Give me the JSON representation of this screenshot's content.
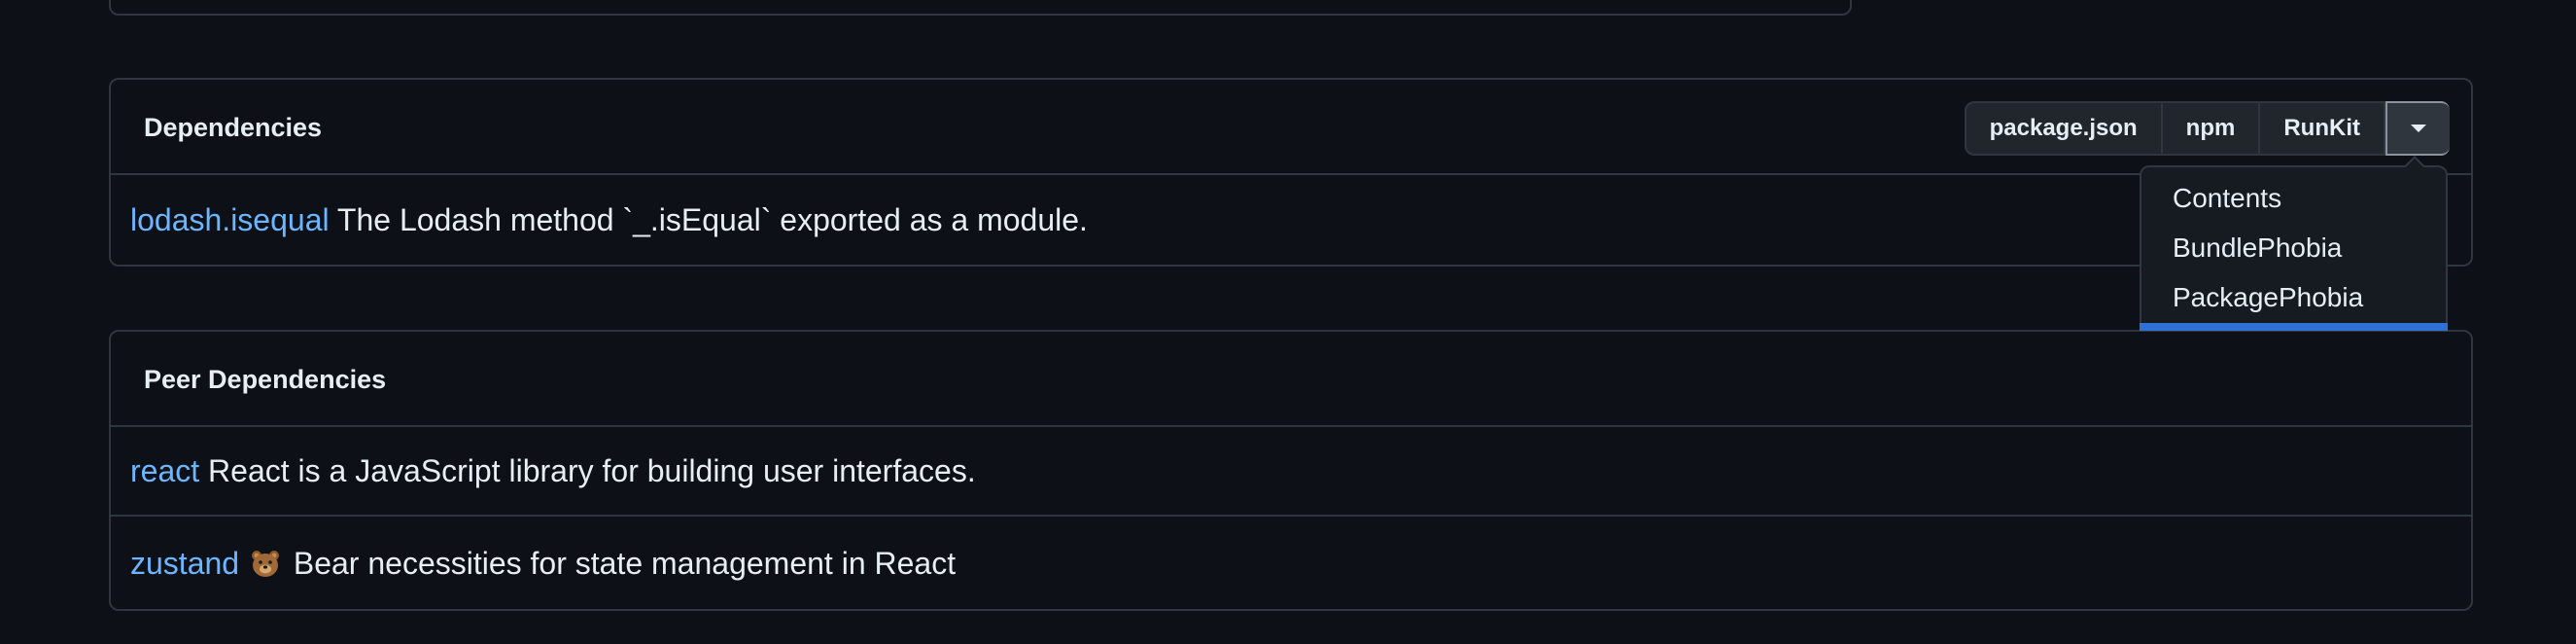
{
  "dependencies": {
    "title": "Dependencies",
    "buttons": {
      "package_json": "package.json",
      "npm": "npm",
      "runkit": "RunKit"
    },
    "items": [
      {
        "name": "lodash.isequal",
        "description": "The Lodash method `_.isEqual` exported as a module."
      }
    ]
  },
  "dropdown": {
    "items": [
      "Contents",
      "BundlePhobia",
      "PackagePhobia"
    ]
  },
  "peer_dependencies": {
    "title": "Peer Dependencies",
    "items": [
      {
        "name": "react",
        "description": "React is a JavaScript library for building user interfaces."
      },
      {
        "name": "zustand",
        "icon": "bear-icon",
        "description": "Bear necessities for state management in React"
      }
    ]
  },
  "colors": {
    "background": "#0d1117",
    "border": "#30363d",
    "link": "#6cb6ff",
    "highlight": "#2f6fd6"
  }
}
